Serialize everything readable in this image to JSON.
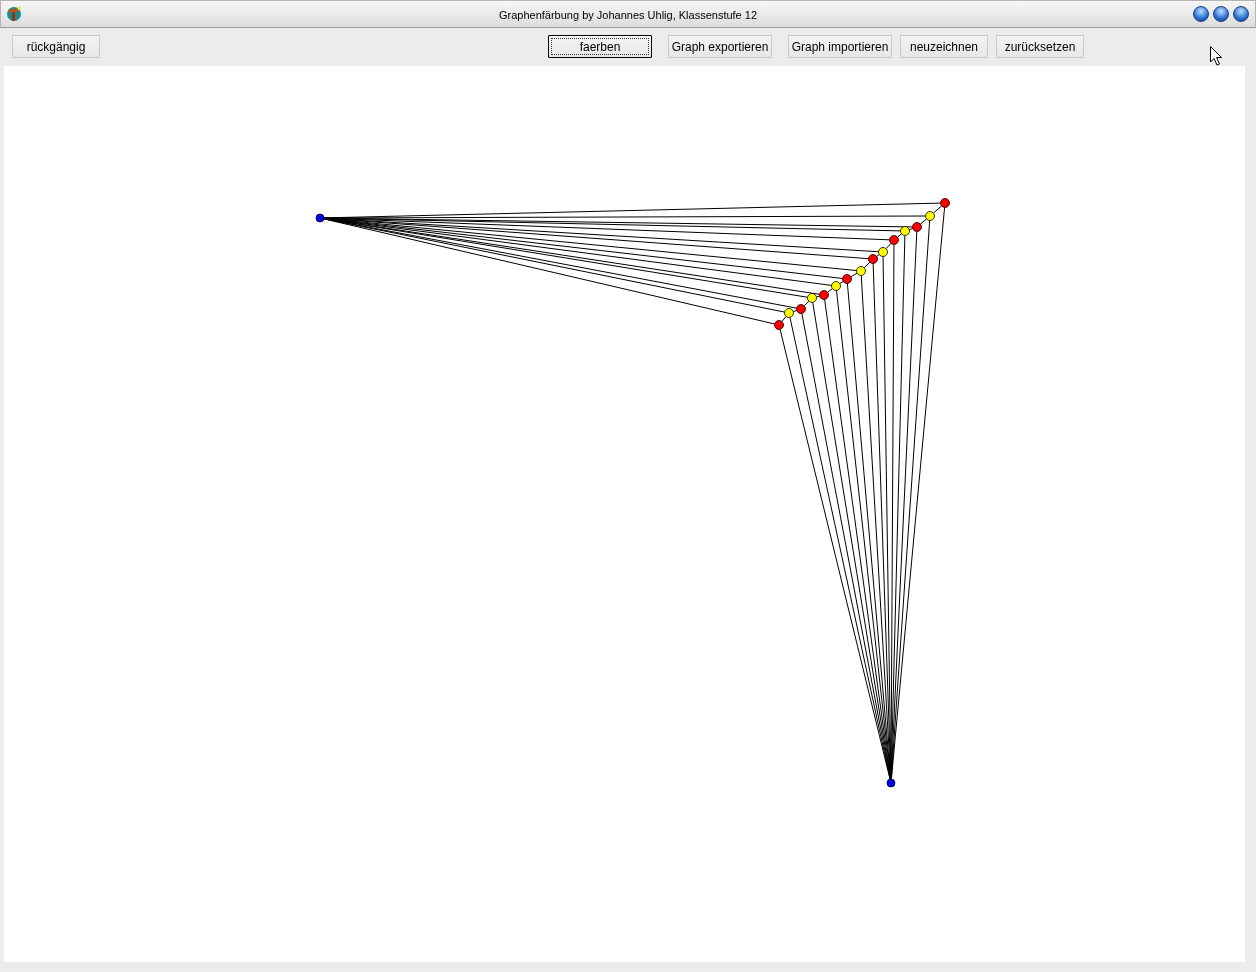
{
  "window": {
    "title": "Graphenfärbung by Johannes Uhlig, Klassenstufe 12"
  },
  "buttons": [
    {
      "label": "rückgängig",
      "focused": false
    },
    {
      "label": "faerben",
      "focused": true
    },
    {
      "label": "Graph exportieren",
      "focused": false
    },
    {
      "label": "Graph importieren",
      "focused": false
    },
    {
      "label": "neuzeichnen",
      "focused": false
    },
    {
      "label": "zurücksetzen",
      "focused": false
    }
  ],
  "graph": {
    "nodes": [
      {
        "color": "#0000ff"
      },
      {
        "color": "#0000ff"
      },
      {
        "color": "#ff0000"
      },
      {
        "color": "#ffff00"
      },
      {
        "color": "#ff0000"
      },
      {
        "color": "#ffff00"
      },
      {
        "color": "#ff0000"
      },
      {
        "color": "#ffff00"
      },
      {
        "color": "#ff0000"
      },
      {
        "color": "#ffff00"
      },
      {
        "color": "#ff0000"
      },
      {
        "color": "#ffff00"
      },
      {
        "color": "#ff0000"
      },
      {
        "color": "#ffff00"
      },
      {
        "color": "#ff0000"
      },
      {
        "color": "#ffff00"
      },
      {
        "color": "#ff0000"
      }
    ]
  }
}
